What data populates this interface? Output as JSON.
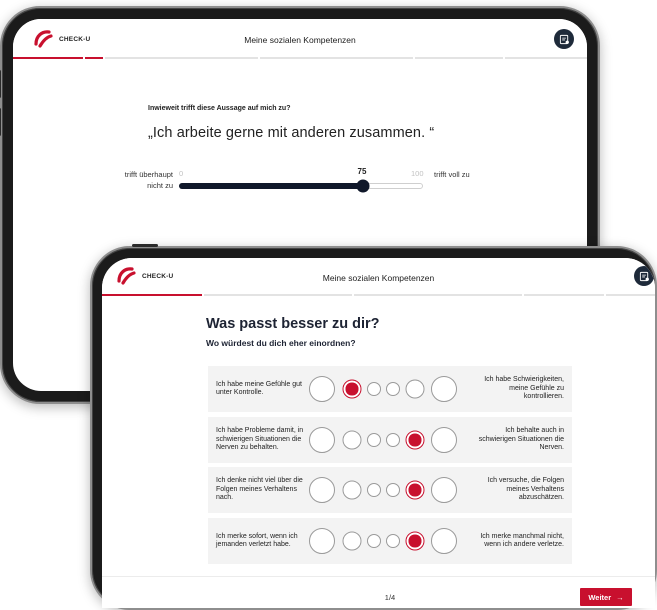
{
  "brand": {
    "logo_text": "CHECK-U",
    "accent": "#c8102e",
    "dark": "#10182a"
  },
  "back_screen": {
    "header_title": "Meine sozialen Kompetenzen",
    "question_label": "Inwieweit trifft diese Aussage auf mich zu?",
    "statement": "„Ich arbeite gerne mit anderen zusammen. “",
    "slider": {
      "left_label": "trifft überhaupt nicht zu",
      "right_label": "trifft voll zu",
      "min": "0",
      "max": "100",
      "value": "75",
      "fraction": 0.75
    },
    "progress_fraction": 0.16,
    "header_icon": "profile-document-icon"
  },
  "front_screen": {
    "header_title": "Meine sozialen Kompetenzen",
    "heading": "Was passt besser zu dir?",
    "subheading": "Wo würdest du dich eher einordnen?",
    "progress_fraction": 0.18,
    "header_icon": "profile-document-icon",
    "rows": [
      {
        "left": "Ich habe meine Gefühle gut unter Kontrolle.",
        "right": "Ich habe Schwierigkeiten, meine Gefühle zu kontrollieren.",
        "selected": 1
      },
      {
        "left": "Ich habe Probleme damit, in schwierigen Situationen die Nerven zu behalten.",
        "right": "Ich behalte auch in schwierigen Situationen die Nerven.",
        "selected": 4
      },
      {
        "left": "Ich denke nicht viel über die Folgen meines Verhaltens nach.",
        "right": "Ich versuche, die Folgen meines Verhaltens abzuschätzen.",
        "selected": 4
      },
      {
        "left": "Ich merke sofort, wenn ich jemanden verletzt habe.",
        "right": "Ich merke manchmal nicht, wenn ich andere verletze.",
        "selected": 4
      }
    ],
    "pager": "1/4",
    "next_label": "Weiter",
    "next_icon": "arrow-right-icon"
  }
}
